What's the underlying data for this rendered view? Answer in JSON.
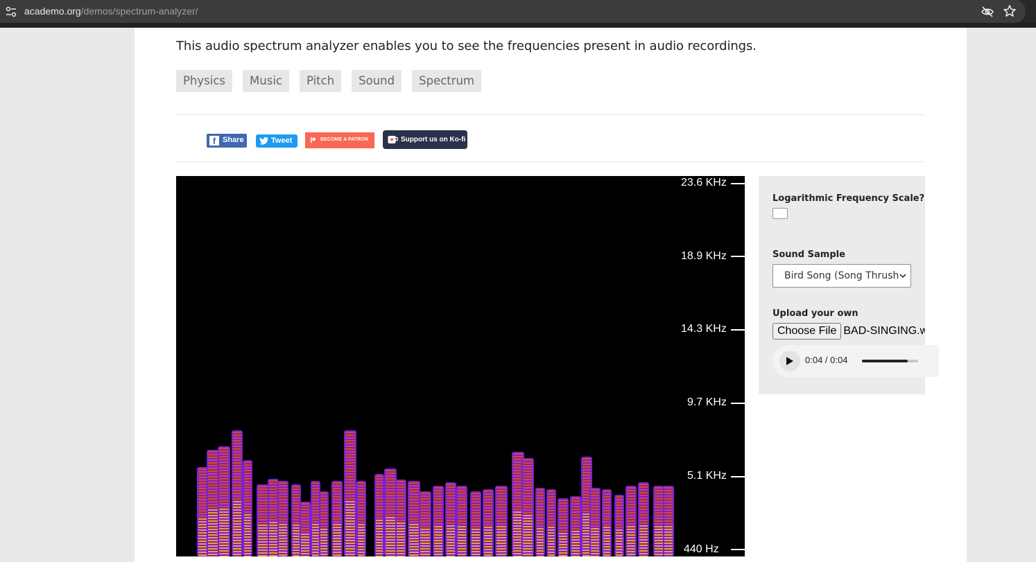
{
  "browser": {
    "url_host": "academo.org",
    "url_path": "/demos/spectrum-analyzer/",
    "icons": [
      "site-settings-icon",
      "eye-off-icon",
      "star-icon"
    ]
  },
  "intro_text": "This audio spectrum analyzer enables you to see the frequencies present in audio recordings.",
  "tags": [
    "Physics",
    "Music",
    "Pitch",
    "Sound",
    "Spectrum"
  ],
  "social": {
    "share": "Share",
    "tweet": "Tweet",
    "patron": "BECOME A PATRON",
    "kofi": "Support us on Ko-fi"
  },
  "spectrum": {
    "axis_labels": [
      "23.6  KHz",
      "18.9  KHz",
      "14.3  KHz",
      "9.7  KHz",
      "5.1  KHz",
      "440  Hz"
    ],
    "colors": {
      "background": "#000000",
      "low": "#7a1fd6",
      "mid": "#d94a1a",
      "high": "#f0a020"
    }
  },
  "controls": {
    "log_scale_label": "Logarithmic Frequency Scale?",
    "log_scale_checked": false,
    "sound_sample_label": "Sound Sample",
    "sound_sample_value": "Bird Song (Song Thrush",
    "upload_label": "Upload your own",
    "choose_file": "Choose File",
    "file_name": "BAD-SINGING.wav",
    "audio_time": "0:04 / 0:04",
    "audio_progress": 0.82
  }
}
